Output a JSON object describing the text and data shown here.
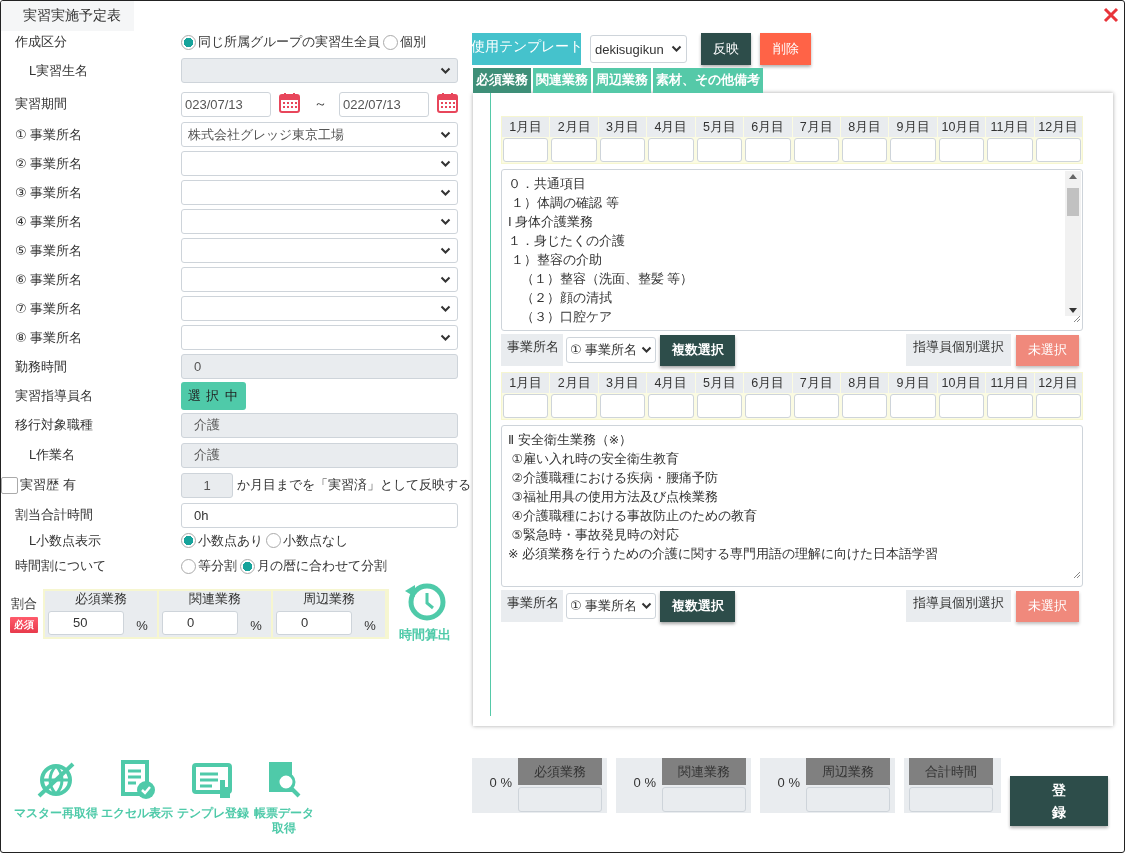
{
  "window": {
    "title": "実習実施予定表"
  },
  "form": {
    "creation_type": {
      "label": "作成区分",
      "options": [
        {
          "label": "同じ所属グループの実習生全員",
          "selected": true
        },
        {
          "label": "個別",
          "selected": false
        }
      ]
    },
    "trainee": {
      "label": "L実習生名",
      "disabled": true
    },
    "period": {
      "label": "実習期間",
      "start": "023/07/13",
      "separator": "～",
      "end": "022/07/13"
    },
    "offices": [
      {
        "label": "① 事業所名",
        "value": "株式会社グレッジ東京工場"
      },
      {
        "label": "② 事業所名"
      },
      {
        "label": "③ 事業所名"
      },
      {
        "label": "④ 事業所名"
      },
      {
        "label": "⑤ 事業所名"
      },
      {
        "label": "⑥ 事業所名"
      },
      {
        "label": "⑦ 事業所名"
      },
      {
        "label": "⑧ 事業所名"
      }
    ],
    "work_hours": {
      "label": "勤務時間",
      "value": "0",
      "disabled": true
    },
    "instructor": {
      "label": "実習指導員名",
      "button": "選 択 中"
    },
    "occupation": {
      "label": "移行対象職種",
      "value": "介護",
      "disabled": true
    },
    "job": {
      "label": "L作業名",
      "value": "介護",
      "disabled": true
    },
    "history": {
      "label": "実習歴 有",
      "checked": false,
      "months": "1",
      "text": "か月目までを「実習済」として反映する"
    },
    "total_hours": {
      "label": "割当合計時間",
      "value": "0h"
    },
    "decimal": {
      "label": "L小数点表示",
      "options": [
        {
          "label": "小数点あり",
          "selected": true
        },
        {
          "label": "小数点なし",
          "selected": false
        }
      ]
    },
    "allocation": {
      "label": "時間割について",
      "options": [
        {
          "label": "等分割",
          "selected": false
        },
        {
          "label": "月の暦に合わせて分割",
          "selected": true
        }
      ]
    },
    "ratio": {
      "label": "割合",
      "badge": "必須",
      "columns": [
        {
          "header": "必須業務",
          "value": "50",
          "unit": "%"
        },
        {
          "header": "関連業務",
          "value": "0",
          "unit": "%"
        },
        {
          "header": "周辺業務",
          "value": "0",
          "unit": "%"
        }
      ]
    },
    "calc_button": {
      "label": "時間算出"
    }
  },
  "tools": [
    {
      "kind": "globe",
      "label": "マスター再取得"
    },
    {
      "kind": "document",
      "label": "エクセル表示"
    },
    {
      "kind": "screen",
      "label": "テンプレ登録"
    },
    {
      "kind": "book",
      "label": "帳票データ取得"
    }
  ],
  "template": {
    "label": "使用テンプレート",
    "value": "dekisugikun",
    "apply": "反映",
    "delete": "削除"
  },
  "tabs": [
    {
      "label": "必須業務",
      "selected": true
    },
    {
      "label": "関連業務",
      "selected": false
    },
    {
      "label": "周辺業務",
      "selected": false
    },
    {
      "label": "素材、その他備考",
      "selected": false
    }
  ],
  "sections": [
    {
      "months": [
        "1月目",
        "2月目",
        "3月目",
        "4月目",
        "5月目",
        "6月目",
        "7月目",
        "8月目",
        "9月目",
        "10月目",
        "11月目",
        "12月目"
      ],
      "scrollable": true,
      "lines": [
        "０．共通項目",
        " １）体調の確認 等",
        "Ⅰ 身体介護業務",
        "１．身じたくの介護",
        " １）整容の介助",
        "　（１）整容（洗面、整髪 等）",
        "　（２）顔の清拭",
        "　（３）口腔ケア"
      ],
      "office_label": "事業所名",
      "office_value": "① 事業所名",
      "multi_button": "複数選択",
      "instructor_label": "指導員個別選択",
      "instructor_button": "未選択"
    },
    {
      "months": [
        "1月目",
        "2月目",
        "3月目",
        "4月目",
        "5月目",
        "6月目",
        "7月目",
        "8月目",
        "9月目",
        "10月目",
        "11月目",
        "12月目"
      ],
      "scrollable": false,
      "lines": [
        "Ⅱ 安全衛生業務（※）",
        " ①雇い入れ時の安全衛生教育",
        " ②介護職種における疾病・腰痛予防",
        " ③福祉用具の使用方法及び点検業務",
        " ④介護職種における事故防止のための教育",
        " ⑤緊急時・事故発見時の対応",
        "※ 必須業務を行うための介護に関する専門用語の理解に向けた日本語学習"
      ],
      "office_label": "事業所名",
      "office_value": "① 事業所名",
      "multi_button": "複数選択",
      "instructor_label": "指導員個別選択",
      "instructor_button": "未選択"
    }
  ],
  "summary": [
    {
      "percent": "0 %",
      "label": "必須業務"
    },
    {
      "percent": "0 %",
      "label": "関連業務"
    },
    {
      "percent": "0 %",
      "label": "周辺業務"
    },
    {
      "label": "合計時間"
    }
  ],
  "register_button": "登録"
}
